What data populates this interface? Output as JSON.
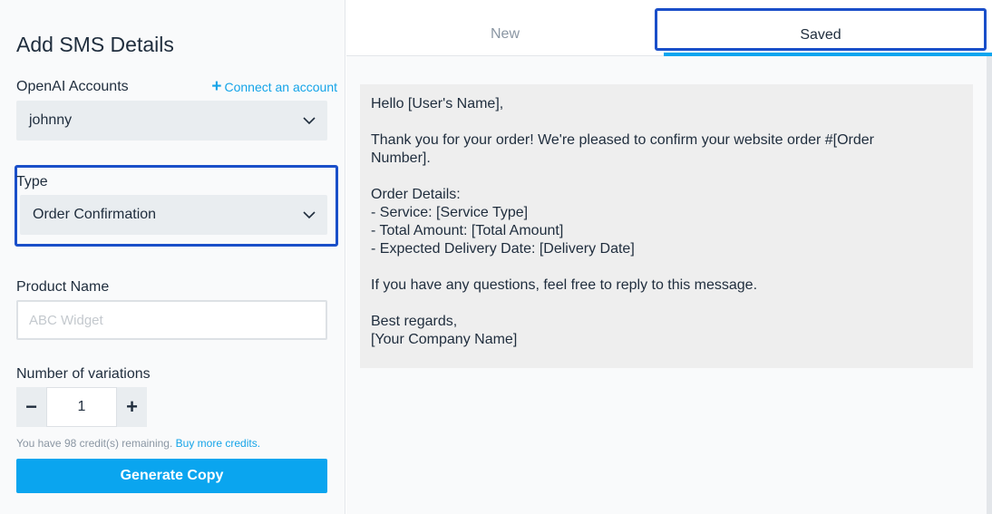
{
  "form": {
    "title": "Add SMS Details",
    "accounts_label": "OpenAI Accounts",
    "connect_plus": "+",
    "connect_label": "Connect an account",
    "account_value": "johnny",
    "type_label": "Type",
    "type_value": "Order Confirmation",
    "product_label": "Product Name",
    "product_placeholder": "ABC Widget",
    "product_value": "",
    "variations_label": "Number of variations",
    "variations_value": "1",
    "minus": "−",
    "plus": "+",
    "credits_text": "You have 98 credit(s) remaining.",
    "buy_link": "Buy more credits.",
    "generate_label": "Generate Copy"
  },
  "tabs": {
    "new_label": "New",
    "saved_label": "Saved",
    "active": "Saved"
  },
  "message": {
    "lines": [
      "Hello [User's Name],",
      "",
      "Thank you for your order! We're pleased to confirm your website order #[Order",
      "Number].",
      "",
      "Order Details:",
      "- Service: [Service Type]",
      "- Total Amount: [Total Amount]",
      "- Expected Delivery Date: [Delivery Date]",
      "",
      "If you have any questions, feel free to reply to this message.",
      "",
      "Best regards,",
      "[Your Company Name]"
    ]
  },
  "colors": {
    "accent": "#0aa5ef",
    "highlight": "#1a4fc9",
    "link": "#15a4e8"
  }
}
